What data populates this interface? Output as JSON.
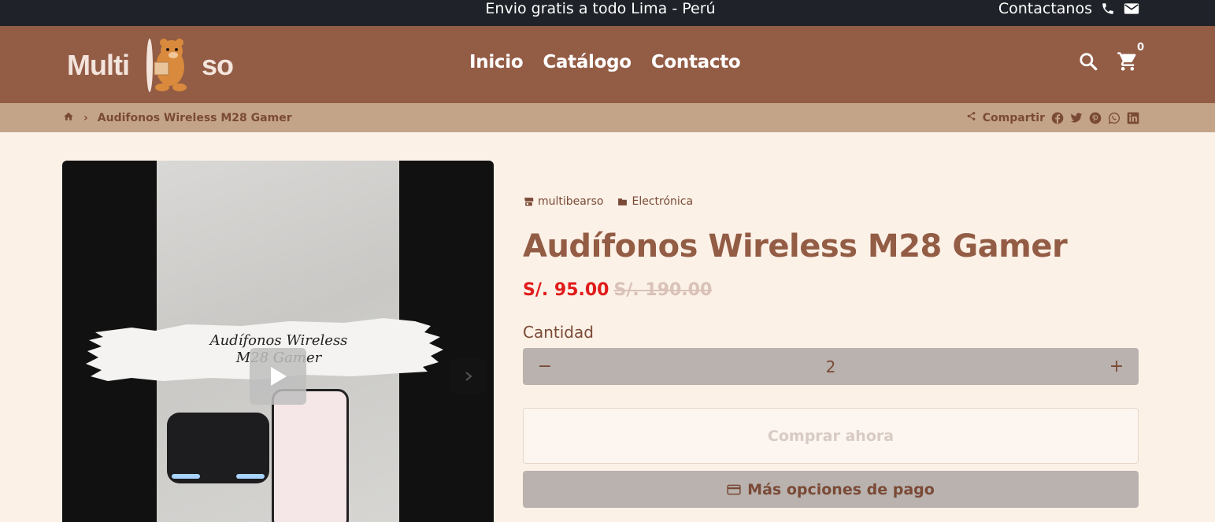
{
  "topbar": {
    "announcement": "Envio gratis a todo Lima - Perú",
    "contact_label": "Contactanos",
    "phone_icon": "phone-icon",
    "mail_icon": "mail-icon"
  },
  "header": {
    "logo_left": "Multi",
    "logo_right": "so",
    "nav": [
      "Inicio",
      "Catálogo",
      "Contacto"
    ],
    "cart_count": "0"
  },
  "breadcrumb": {
    "home_icon": "home-icon",
    "separator": "›",
    "current": "Audifonos Wireless M28 Gamer",
    "share_label": "Compartir",
    "social": [
      "facebook-icon",
      "twitter-icon",
      "pinterest-icon",
      "whatsapp-icon",
      "linkedin-icon"
    ]
  },
  "media": {
    "caption_line1": "Audífonos Wireless",
    "caption_line2": "M28 Gamer"
  },
  "product": {
    "vendor": "multibearso",
    "category": "Electrónica",
    "title": "Audífonos Wireless M28 Gamer",
    "price": "S/. 95.00",
    "compare_price": "S/. 190.00",
    "quantity_label": "Cantidad",
    "quantity": "2",
    "minus": "−",
    "plus": "+",
    "buy_now": "Comprar ahora",
    "more_payment": "Más opciones de pago"
  },
  "colors": {
    "header_bg": "#935c45",
    "topbar_bg": "#1f2329",
    "breadcrumb_bg": "#c4a488",
    "page_bg": "#fcf1e7",
    "sale_price": "#e01b1b"
  }
}
